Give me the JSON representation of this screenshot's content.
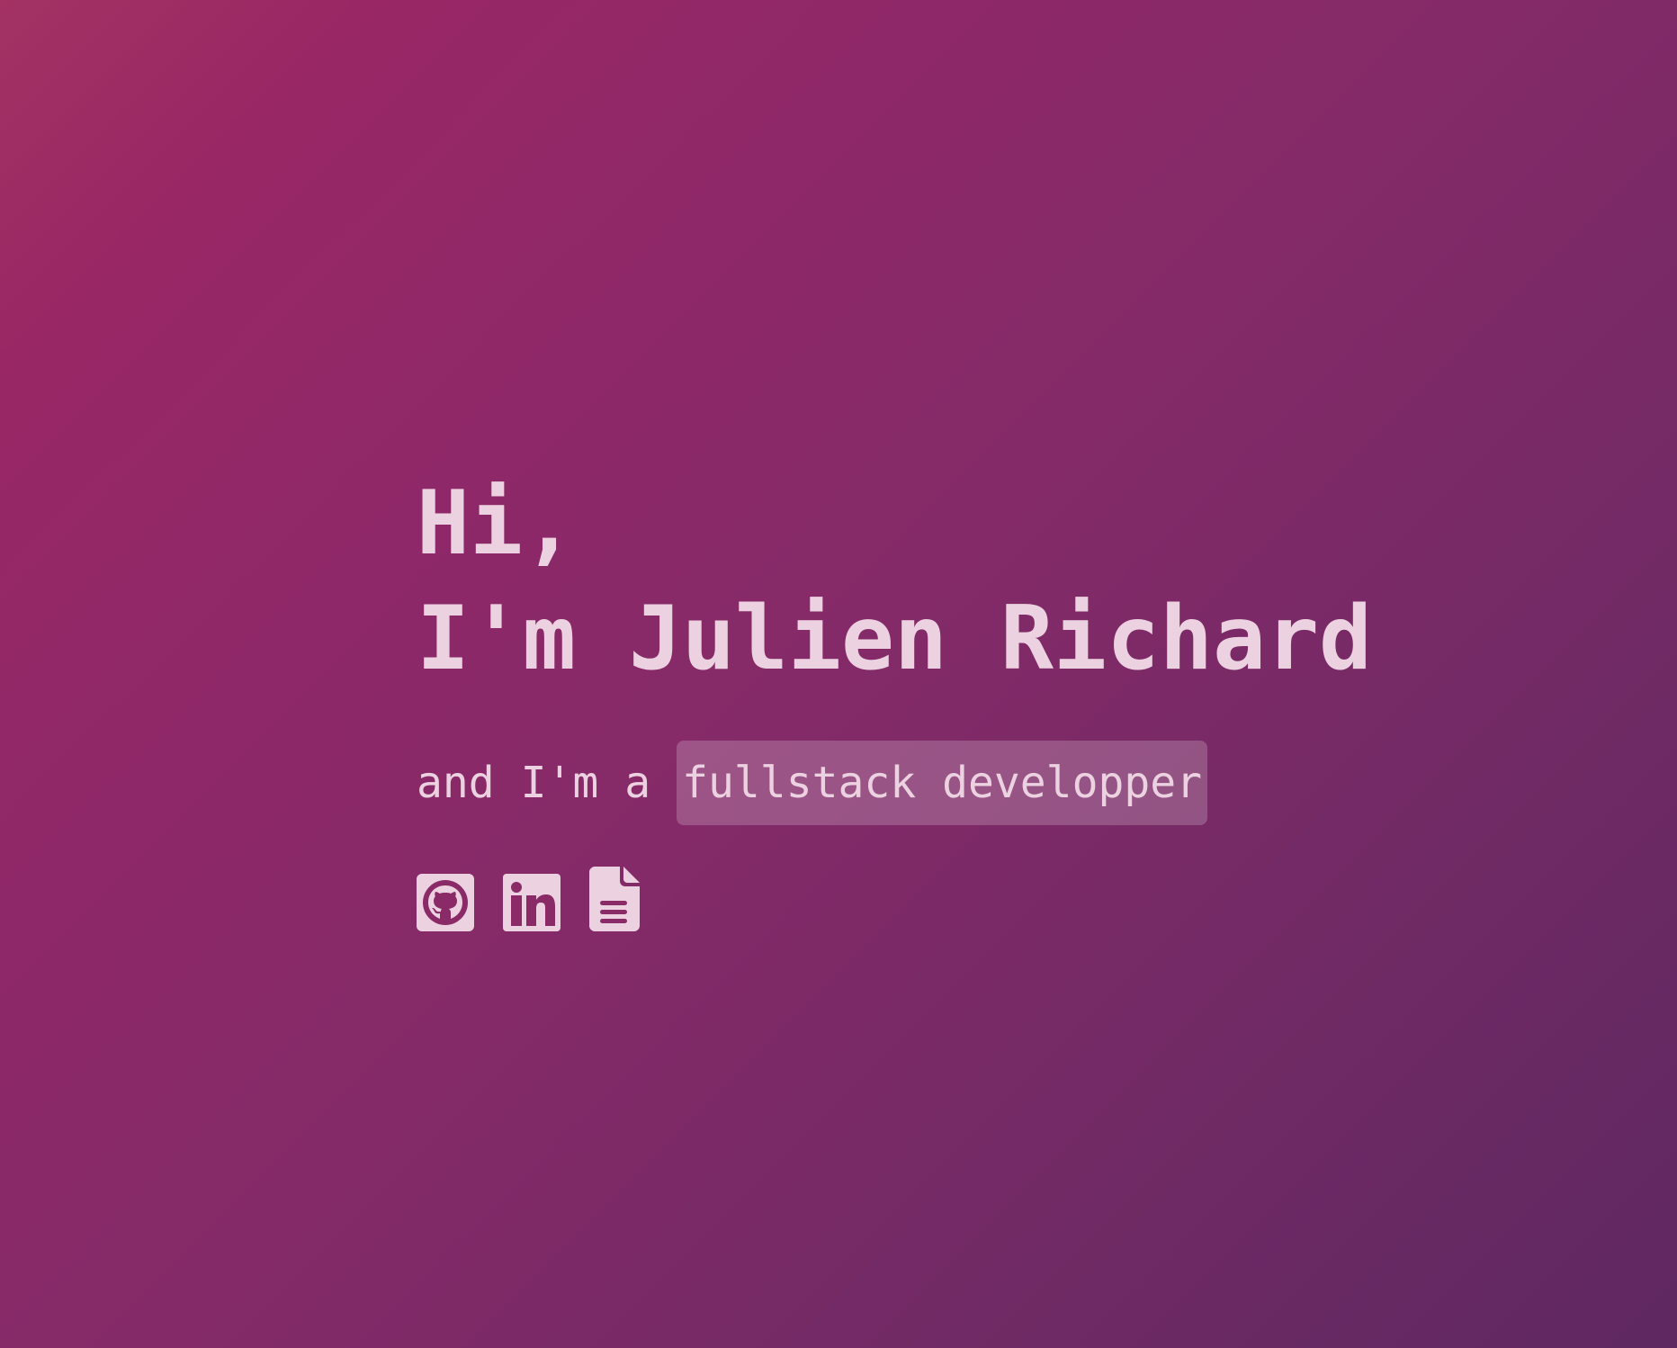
{
  "hero": {
    "greeting_line1": "Hi,",
    "greeting_line2": "I'm Julien Richard",
    "tagline_prefix": "and I'm a",
    "tagline_highlight": "fullstack developper"
  },
  "socials": [
    {
      "name": "github",
      "icon": "github-icon"
    },
    {
      "name": "linkedin",
      "icon": "linkedin-icon"
    },
    {
      "name": "resume",
      "icon": "document-icon"
    }
  ],
  "colors": {
    "background_start": "#a33363",
    "background_end": "#5f2861",
    "text": "#ecd2e0",
    "highlight_bg": "rgba(255,255,255,0.2)"
  }
}
